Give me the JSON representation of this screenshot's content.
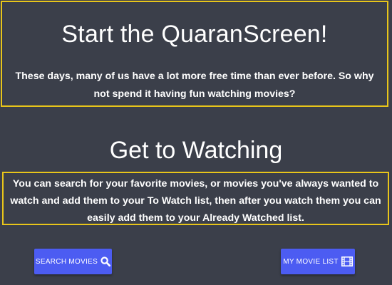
{
  "hero": {
    "title": "Start the QuaranScreen!",
    "text": "These days, many of us have a lot more free time than ever before. So why not spend it having fun watching movies?"
  },
  "section": {
    "title": "Get to Watching",
    "text": "You can search for your favorite movies, or movies you've always wanted to watch and add them to your To Watch list, then after you watch them you can easily add them to your Already Watched list."
  },
  "buttons": {
    "search_label": "Search Movies",
    "list_label": "My Movie List",
    "search_icon": "search-icon",
    "list_icon": "film-icon"
  },
  "colors": {
    "background": "#3b3f4a",
    "border_accent": "#e8c51a",
    "button": "#4c5cf2"
  }
}
